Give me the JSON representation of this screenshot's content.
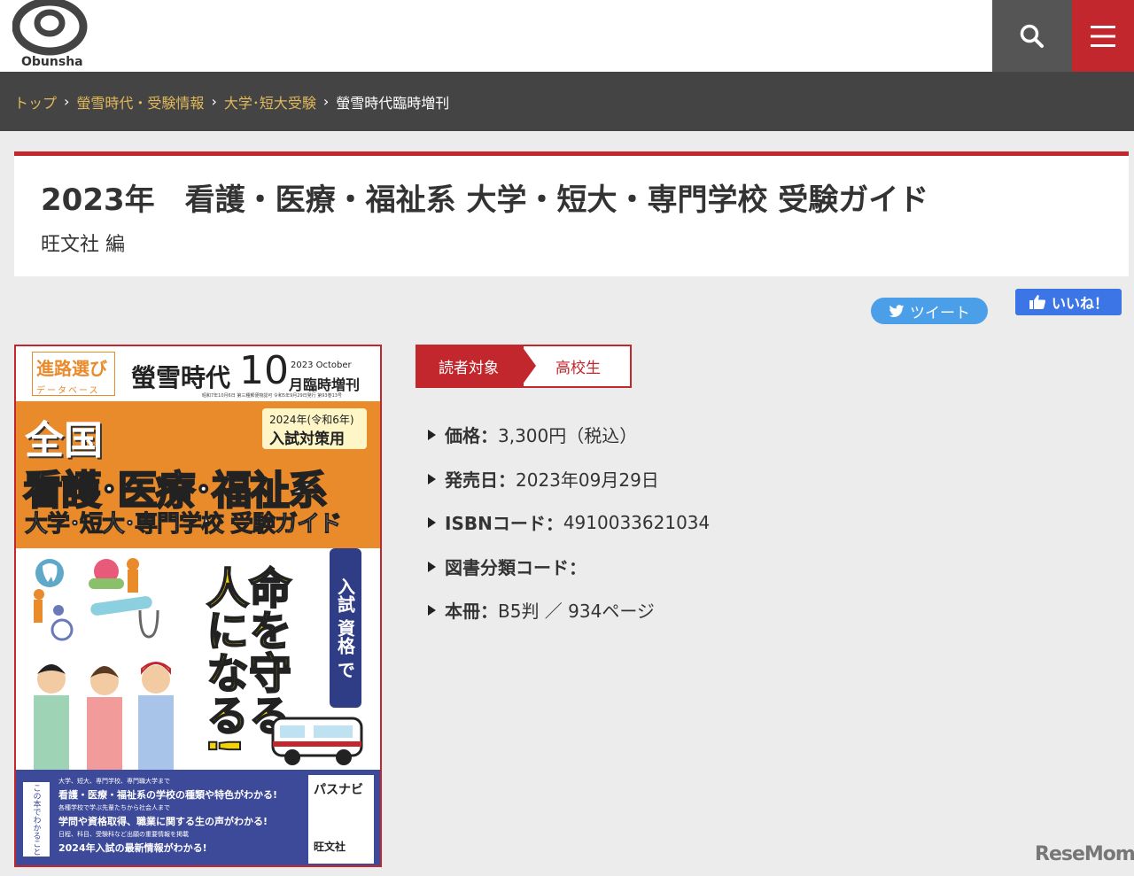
{
  "header": {
    "logo_text": "Obunsha",
    "search_icon": "search-icon",
    "menu_icon": "hamburger-menu-icon",
    "accent_color": "#c1272d"
  },
  "breadcrumb": {
    "items": [
      "トップ",
      "螢雪時代・受験情報",
      "大学･短大受験",
      "螢雪時代臨時増刊"
    ],
    "separator": ">"
  },
  "book": {
    "title": "2023年　看護・医療・福祉系 大学・短大・専門学校 受験ガイド",
    "author": "旺文社 編"
  },
  "social": {
    "tweet_label": "ツイート",
    "like_label": "いいね！"
  },
  "cover": {
    "series": "進路選び",
    "series_sub": "データベース",
    "magazine": "螢雪時代",
    "issue_number": "10",
    "issue_en": "2023 October",
    "issue_label": "月臨時増刊",
    "small_print": "昭和7年10月6日 第三種郵便物認可 令和5年9月29日発行 第93巻13号",
    "zenkoku": "全国",
    "badge_year": "2024年(令和6年)",
    "badge_text": "入試対策用",
    "main_title": "看護･医療･福祉系",
    "sub_title": "大学･短大･専門学校 受験ガイド",
    "slogan": "命を守る人になる!",
    "tag": "入試 資格 で",
    "vertical_note": "この本でわかること",
    "bottom_lines": [
      "大学、短大、専門学校、専門職大学まで",
      "看護・医療・福祉系の学校の種類や特色がわかる!",
      "各種学校で学ぶ先輩たちから社会人まで",
      "学問や資格取得、職業に関する生の声がわかる!",
      "日程、科目、受験科など出願の重要情報を掲載",
      "2024年入試の最新情報がわかる!"
    ],
    "basugai": "パスナビ",
    "publisher": "旺文社"
  },
  "details": {
    "target_label": "読者対象",
    "target_value": "高校生",
    "items": [
      {
        "label": "価格：",
        "value": "3,300円（税込）"
      },
      {
        "label": "発売日：",
        "value": "2023年09月29日"
      },
      {
        "label": "ISBNコード：",
        "value": "4910033621034"
      },
      {
        "label": "図書分類コード：",
        "value": ""
      },
      {
        "label": "本冊：",
        "value": "B5判 ／ 934ページ"
      }
    ]
  },
  "watermark": "ReseMom"
}
